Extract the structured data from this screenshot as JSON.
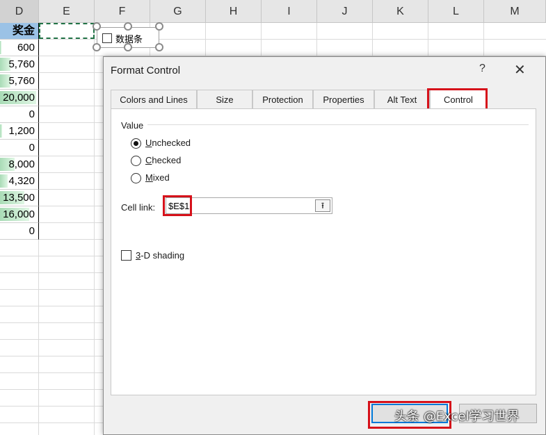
{
  "sheet": {
    "columns": [
      "D",
      "E",
      "F",
      "G",
      "H",
      "I",
      "J",
      "K",
      "L",
      "M"
    ],
    "selected_column": "D",
    "column_d_header": "奖金",
    "column_d_values": [
      {
        "text": "600",
        "bar": 0.03
      },
      {
        "text": "5,760",
        "bar": 0.29
      },
      {
        "text": "5,760",
        "bar": 0.29
      },
      {
        "text": "20,000",
        "bar": 1.0
      },
      {
        "text": "0",
        "bar": 0
      },
      {
        "text": "1,200",
        "bar": 0.06
      },
      {
        "text": "0",
        "bar": 0
      },
      {
        "text": "8,000",
        "bar": 0.4
      },
      {
        "text": "4,320",
        "bar": 0.22
      },
      {
        "text": "13,500",
        "bar": 0.68
      },
      {
        "text": "16,000",
        "bar": 0.8
      },
      {
        "text": "0",
        "bar": 0
      }
    ],
    "form_checkbox_label": "数据条"
  },
  "dialog": {
    "title": "Format Control",
    "help": "?",
    "close": "✕",
    "tabs": [
      "Colors and Lines",
      "Size",
      "Protection",
      "Properties",
      "Alt Text",
      "Control"
    ],
    "active_tab": "Control",
    "value_group_label": "Value",
    "radios": [
      {
        "key": "U",
        "rest": "nchecked",
        "checked": true
      },
      {
        "key": "C",
        "rest": "hecked",
        "checked": false
      },
      {
        "key": "M",
        "rest": "ixed",
        "checked": false
      }
    ],
    "cell_link_label": "Cell link:",
    "cell_link_value": "$E$1",
    "collapse_icon": "⭱",
    "shading_key": "3",
    "shading_rest": "-D shading",
    "ok_label": "",
    "cancel_label": "",
    "watermark": "头条 @Excel学习世界"
  },
  "colors": {
    "highlight_red": "#d6111a",
    "header_fill": "#9bc2e6",
    "databar_green": "#63be7b"
  }
}
